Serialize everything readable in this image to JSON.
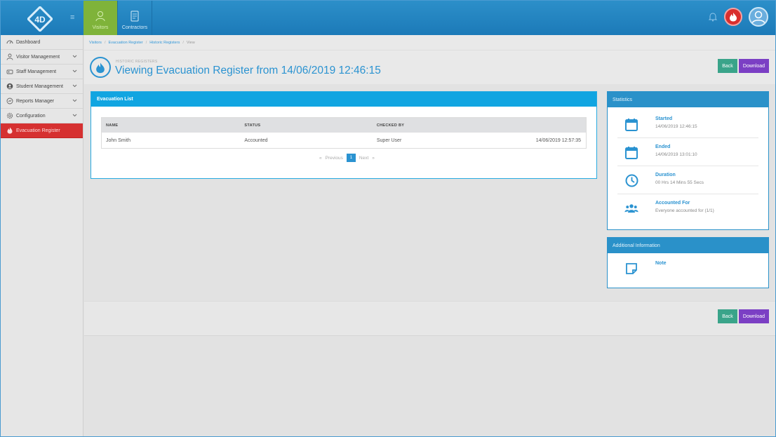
{
  "topbar": {
    "menu_glyph": "≡",
    "nav": [
      {
        "label": "Visitors",
        "icon": "person-icon",
        "active": true
      },
      {
        "label": "Contractors",
        "icon": "document-icon",
        "active": false
      }
    ]
  },
  "sidebar": {
    "items": [
      {
        "label": "Dashboard",
        "icon": "dashboard-icon",
        "has_chevron": false
      },
      {
        "label": "Visitor Management",
        "icon": "person-icon",
        "has_chevron": true
      },
      {
        "label": "Staff Management",
        "icon": "staff-icon",
        "has_chevron": true
      },
      {
        "label": "Student Management",
        "icon": "student-icon",
        "has_chevron": true
      },
      {
        "label": "Reports Manager",
        "icon": "report-icon",
        "has_chevron": true
      },
      {
        "label": "Configuration",
        "icon": "gear-icon",
        "has_chevron": true
      },
      {
        "label": "Evacuation Register",
        "icon": "fire-icon",
        "has_chevron": false,
        "active": true
      }
    ]
  },
  "breadcrumb": {
    "items": [
      "Visitors",
      "Evacuation Register",
      "Historic Registers"
    ],
    "current": "View",
    "separator": "/"
  },
  "header": {
    "subtitle": "HISTORIC REGISTERS",
    "title": "Viewing Evacuation Register from 14/06/2019 12:46:15"
  },
  "actions": {
    "back_label": "Back",
    "download_label": "Download"
  },
  "evacuation_list": {
    "title": "Evacuation List",
    "columns": [
      "NAME",
      "STATUS",
      "CHECKED BY",
      ""
    ],
    "rows": [
      {
        "name": "John Smith",
        "status": "Accounted",
        "checked_by": "Super User",
        "time": "14/06/2019 12:57:35"
      }
    ],
    "pager": {
      "prev_arrow": "«",
      "prev": "Previous",
      "page": "1",
      "next": "Next",
      "next_arrow": "»"
    }
  },
  "statistics": {
    "title": "Statistics",
    "items": [
      {
        "label": "Started",
        "value": "14/06/2019 12:46:15",
        "icon": "calendar-icon"
      },
      {
        "label": "Ended",
        "value": "14/06/2019 13:01:10",
        "icon": "calendar-icon"
      },
      {
        "label": "Duration",
        "value": "00 Hrs 14 Mins 55 Secs",
        "icon": "clock-icon"
      },
      {
        "label": "Accounted For",
        "value": "Everyone accounted for (1/1)",
        "icon": "people-icon"
      }
    ]
  },
  "additional_info": {
    "title": "Additional Information",
    "items": [
      {
        "label": "Note",
        "icon": "note-icon"
      }
    ]
  },
  "colors": {
    "brand_blue": "#2b93d1",
    "active_green": "#7fb33a",
    "alert_red": "#d63131",
    "back_teal": "#3aa48a",
    "download_purple": "#7b3fc4"
  }
}
